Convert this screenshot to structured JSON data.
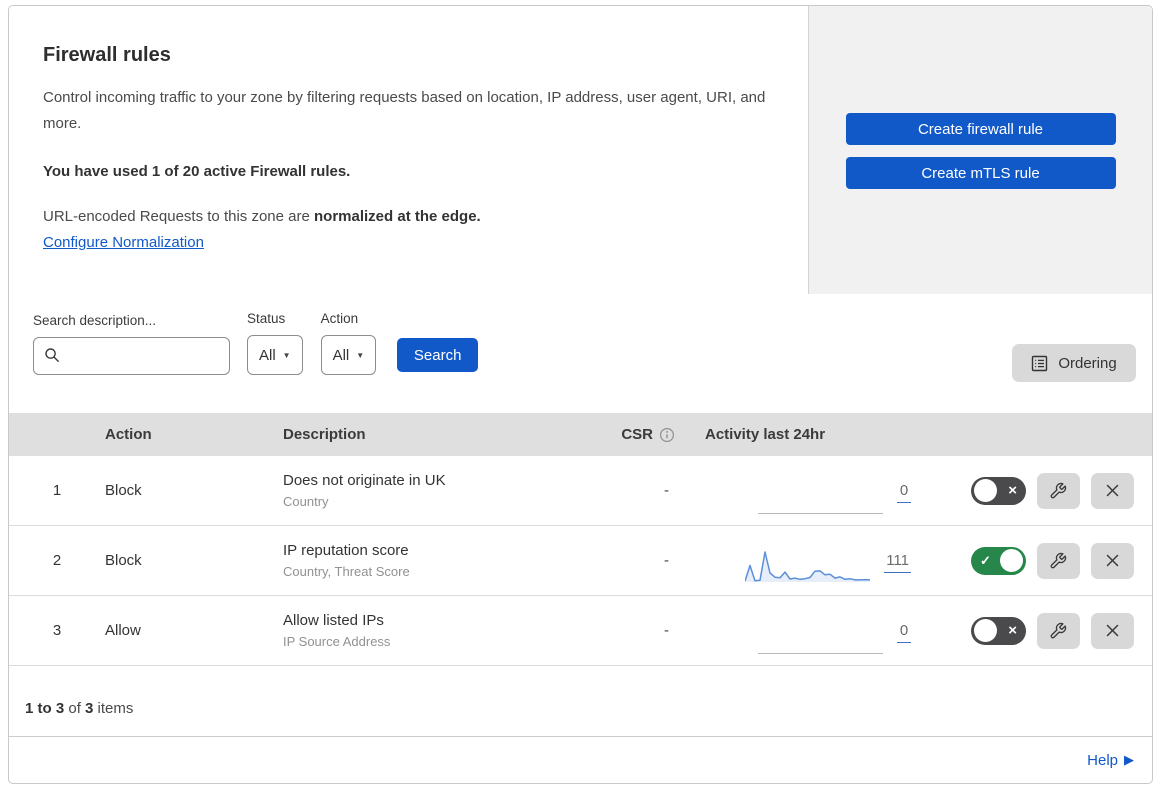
{
  "colors": {
    "brand_blue": "#1159C9",
    "toggle_on_green": "#27874B",
    "toggle_off_gray": "#4A4A4D",
    "panel_gray": "#F1F1F1",
    "table_header_gray": "#DFDFDF",
    "control_gray": "#D9D9D9",
    "sparkline_stroke": "#5B8FD9",
    "sparkline_fill": "rgba(91,143,217,0.15)"
  },
  "icons": {
    "check": "✓",
    "cross": "×",
    "caret_down": "▼",
    "help_arrow": "▶"
  },
  "header": {
    "title": "Firewall rules",
    "description": "Control incoming traffic to your zone by filtering requests based on location, IP address, user agent, URI, and more.",
    "usage_line": "You have used 1 of 20 active Firewall rules.",
    "normalization_text": "URL-encoded Requests to this zone are ",
    "normalization_bold": "normalized at the edge.",
    "normalization_link": "Configure Normalization",
    "create_firewall_button": "Create firewall rule",
    "create_mtls_button": "Create mTLS rule"
  },
  "filters": {
    "search_label": "Search description...",
    "status_label": "Status",
    "status_value": "All",
    "action_label": "Action",
    "action_value": "All",
    "search_button": "Search",
    "ordering_button": "Ordering"
  },
  "table": {
    "columns": {
      "action": "Action",
      "description": "Description",
      "csr": "CSR",
      "activity": "Activity last 24hr"
    },
    "rows": [
      {
        "priority": "1",
        "action": "Block",
        "description": "Does not originate in UK",
        "fields": "Country",
        "csr": "-",
        "activity_count": "0",
        "activity_type": "flat",
        "enabled": false
      },
      {
        "priority": "2",
        "action": "Block",
        "description": "IP reputation score",
        "fields": "Country, Threat Score",
        "csr": "-",
        "activity_count": "111",
        "activity_type": "sparkline",
        "enabled": true
      },
      {
        "priority": "3",
        "action": "Allow",
        "description": "Allow listed IPs",
        "fields": "IP Source Address",
        "csr": "-",
        "activity_count": "0",
        "activity_type": "flat",
        "enabled": false
      }
    ],
    "summary": {
      "range": "1 to 3",
      "of": " of ",
      "total": "3",
      "items": " items"
    }
  },
  "chart_data": {
    "type": "line",
    "title": "Activity last 24hr sparkline (rule 2)",
    "values": [
      3,
      55,
      4,
      6,
      100,
      30,
      16,
      14,
      33,
      10,
      13,
      9,
      11,
      15,
      36,
      37,
      24,
      26,
      13,
      17,
      9,
      11,
      7,
      7,
      8,
      7
    ],
    "ylim": [
      0,
      100
    ],
    "total_label": "111"
  },
  "footer": {
    "help_label": "Help"
  }
}
